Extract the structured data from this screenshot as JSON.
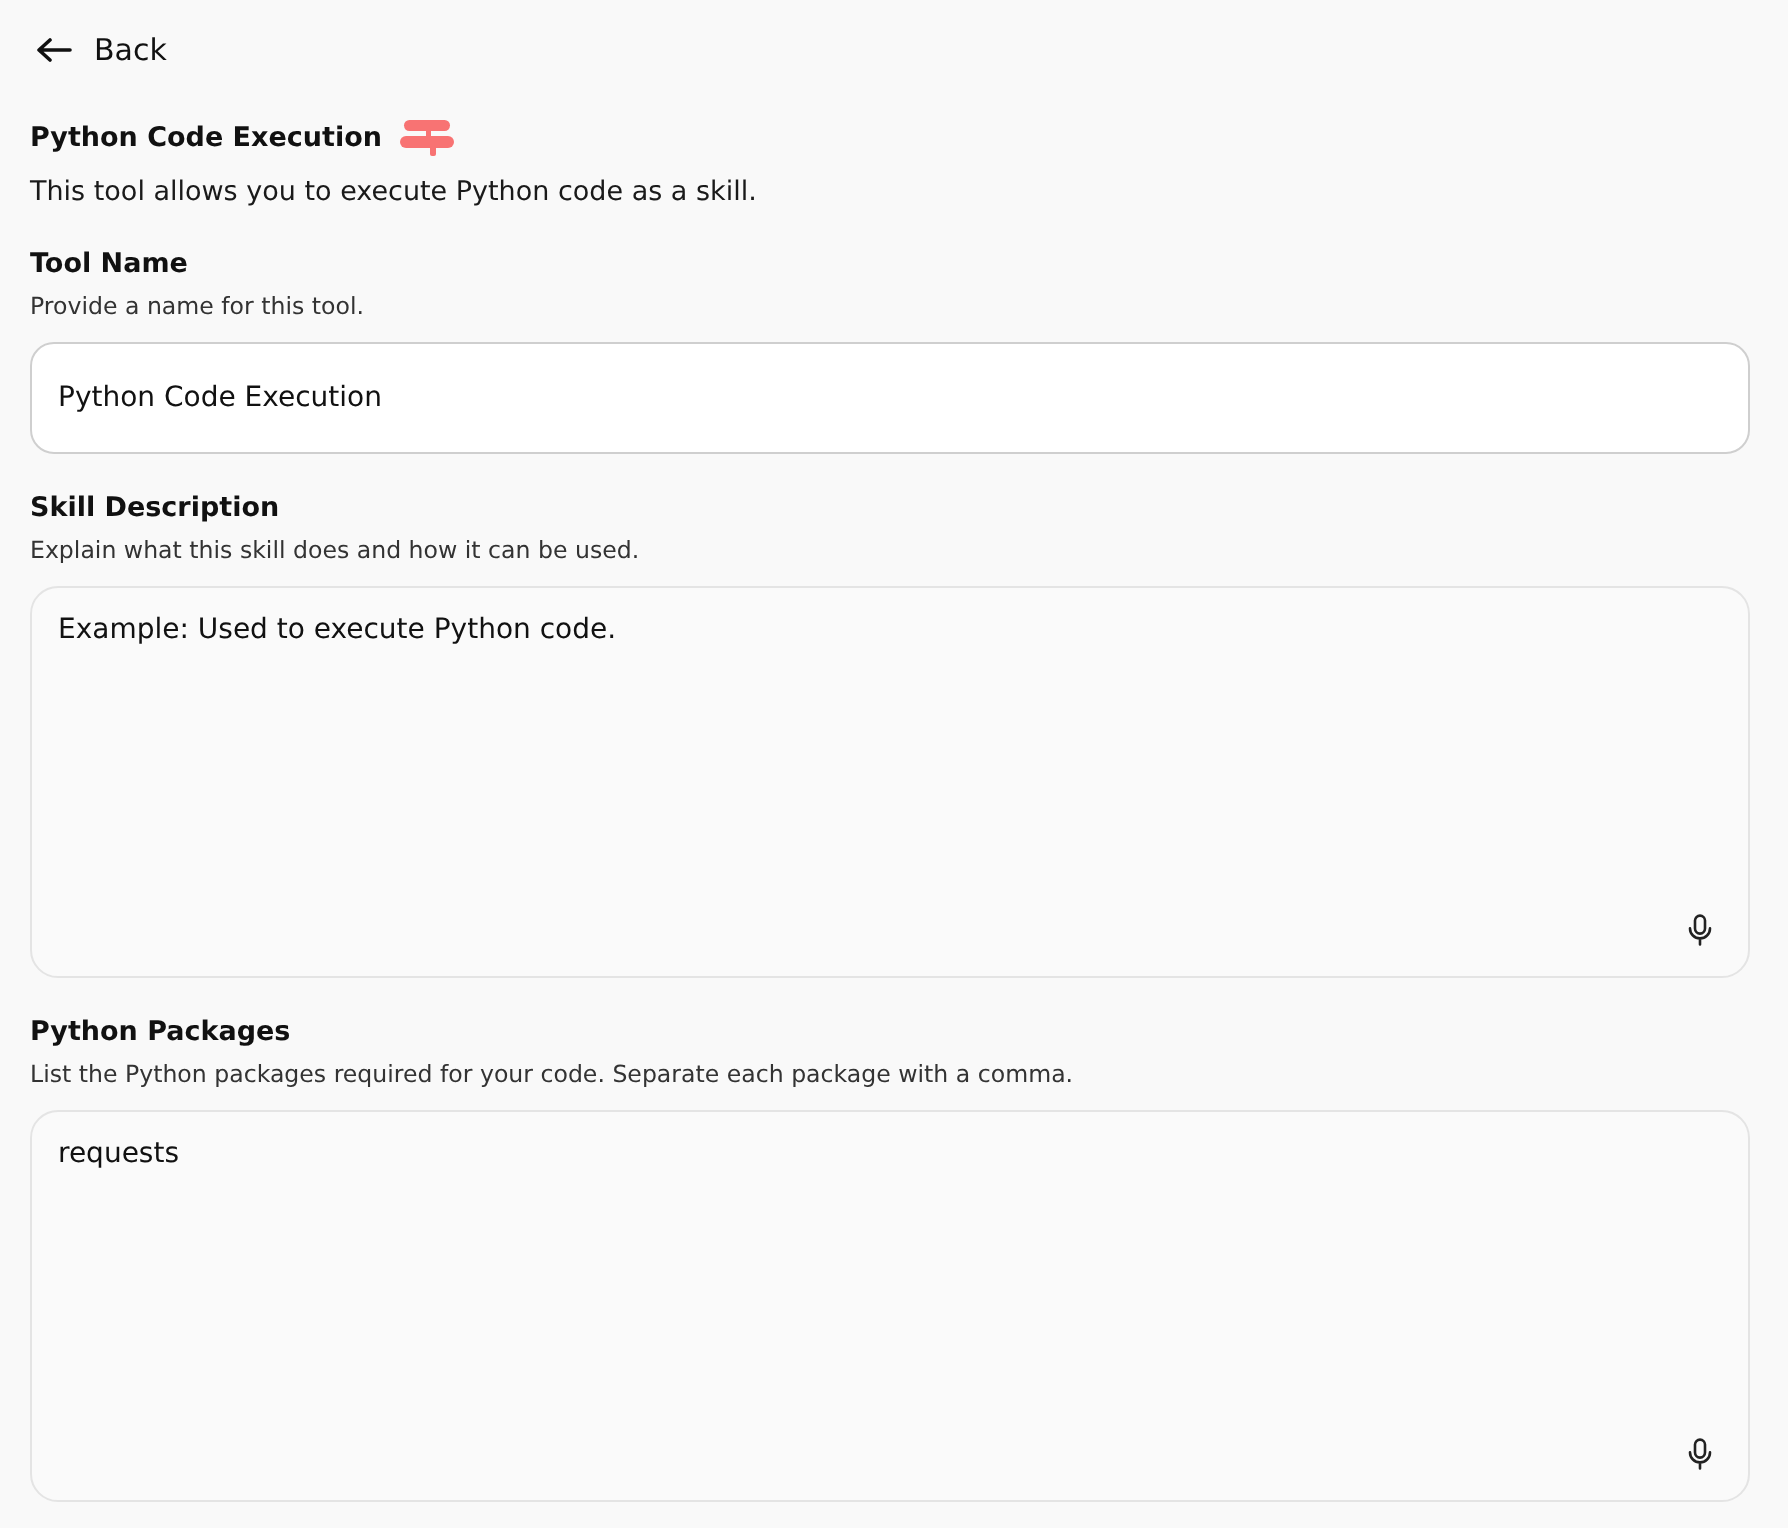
{
  "back": {
    "label": "Back"
  },
  "header": {
    "title": "Python Code Execution",
    "description": "This tool allows you to execute Python code as a skill."
  },
  "fields": [
    {
      "kind": "input",
      "label": "Tool Name",
      "hint": "Provide a name for this tool.",
      "value": "Python Code Execution"
    },
    {
      "kind": "textarea",
      "label": "Skill Description",
      "hint": "Explain what this skill does and how it can be used.",
      "value": "Example: Used to execute Python code."
    },
    {
      "kind": "textarea",
      "label": "Python Packages",
      "hint": "List the Python packages required for your code. Separate each package with a comma.",
      "value": "requests"
    }
  ]
}
